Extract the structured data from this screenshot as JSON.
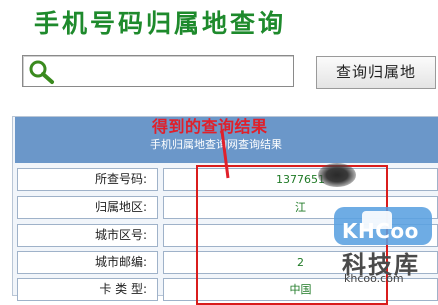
{
  "app": {
    "title": "手机号码归属地查询"
  },
  "search": {
    "value": "",
    "button_label": "查询归属地"
  },
  "result": {
    "annotation": "得到的查询结果",
    "header": "手机归属地查询网查询结果",
    "rows": [
      {
        "label": "所查号码:",
        "value": "1377651"
      },
      {
        "label": "归属地区:",
        "value": "江"
      },
      {
        "label": "城市区号:",
        "value": ""
      },
      {
        "label": "城市邮编:",
        "value": "2"
      },
      {
        "label": "卡 类 型:",
        "value": "中国"
      }
    ]
  },
  "watermark": {
    "logo": "KHCoo",
    "name": "科技库",
    "url": "khcoo.com"
  },
  "colors": {
    "title": "#1e8a2c",
    "header_bg": "#6b97c9",
    "annotation": "#e0202a",
    "value": "#1f7a26"
  }
}
